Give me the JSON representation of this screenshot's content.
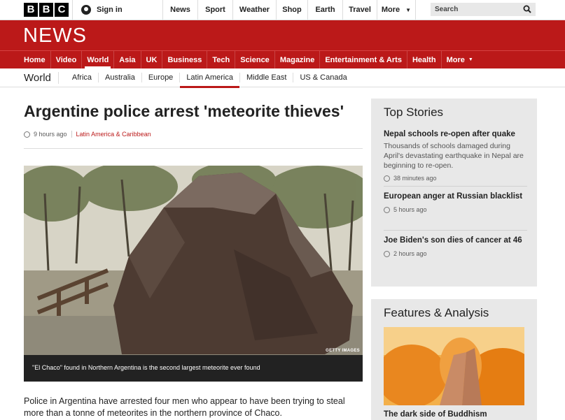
{
  "header": {
    "logo_letters": [
      "B",
      "B",
      "C"
    ],
    "signin_label": "Sign in",
    "nav": [
      "News",
      "Sport",
      "Weather",
      "Shop",
      "Earth",
      "Travel",
      "More"
    ],
    "search_placeholder": "Search"
  },
  "news_logo": "NEWS",
  "main_nav": [
    "Home",
    "Video",
    "World",
    "Asia",
    "UK",
    "Business",
    "Tech",
    "Science",
    "Magazine",
    "Entertainment & Arts",
    "Health",
    "More"
  ],
  "main_nav_active": "World",
  "sub_nav": {
    "section": "World",
    "items": [
      "Africa",
      "Australia",
      "Europe",
      "Latin America",
      "Middle East",
      "US & Canada"
    ],
    "active": "Latin America"
  },
  "article": {
    "headline": "Argentine police arrest 'meteorite thieves'",
    "time": "9 hours ago",
    "tag": "Latin America & Caribbean",
    "image_credit": "GETTY IMAGES",
    "caption": "\"El Chaco\" found in Northern Argentina is the second largest meteorite ever found",
    "body": "Police in Argentina have arrested four men who appear to have been trying to steal more than a tonne of meteorites in the northern province of Chaco."
  },
  "top_stories": {
    "title": "Top Stories",
    "items": [
      {
        "title": "Nepal schools re-open after quake",
        "summary": "Thousands of schools damaged during April's devastating earthquake in Nepal are beginning to re-open.",
        "time": "38 minutes ago"
      },
      {
        "title": "European anger at Russian blacklist",
        "summary": "",
        "time": "5 hours ago"
      },
      {
        "title": "Joe Biden's son dies of cancer at 46",
        "summary": "",
        "time": "2 hours ago"
      }
    ]
  },
  "features": {
    "title": "Features & Analysis",
    "first_title": "The dark side of Buddhism"
  },
  "colors": {
    "brand_red": "#bb1919",
    "panel_grey": "#e8e8e8"
  }
}
